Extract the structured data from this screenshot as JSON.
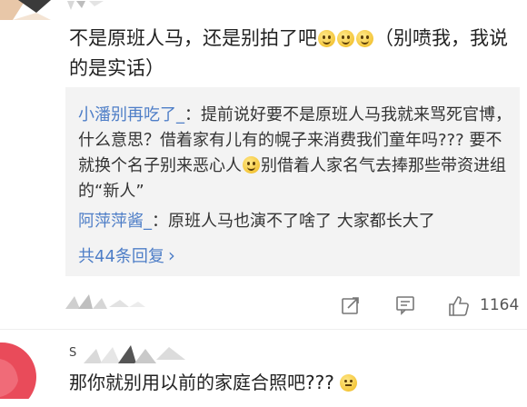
{
  "comment1": {
    "text_a": "不是原班人马，还是别拍了吧",
    "text_b": "（别喷我，我说的是实话）"
  },
  "replies": [
    {
      "user": "小潘别再吃了_",
      "sep": "：",
      "text_a": "提前说好要不是原班人马我就来骂死官博，什么意思？借着家有儿有的幌子来消费我们童年吗??? 要不就换个名子别来恶心人",
      "text_b": "别借着人家名气去捧那些带资进组的“新人”"
    },
    {
      "user": "阿萍萍酱_",
      "sep": "：",
      "text": "原班人马也演不了啥了 大家都长大了"
    }
  ],
  "more_replies": {
    "label": "共44条回复",
    "chevron": "›"
  },
  "actions": {
    "share_icon": "share-icon",
    "comment_icon": "comment-icon",
    "like_icon": "thumbs-up-icon",
    "like_count": "1164"
  },
  "comment2": {
    "text": "那你就别用以前的家庭合照吧???"
  },
  "colors": {
    "link_blue": "#4e7ec7",
    "reply_bg": "#f3f3f3",
    "avatar_red": "#e94b5a"
  }
}
